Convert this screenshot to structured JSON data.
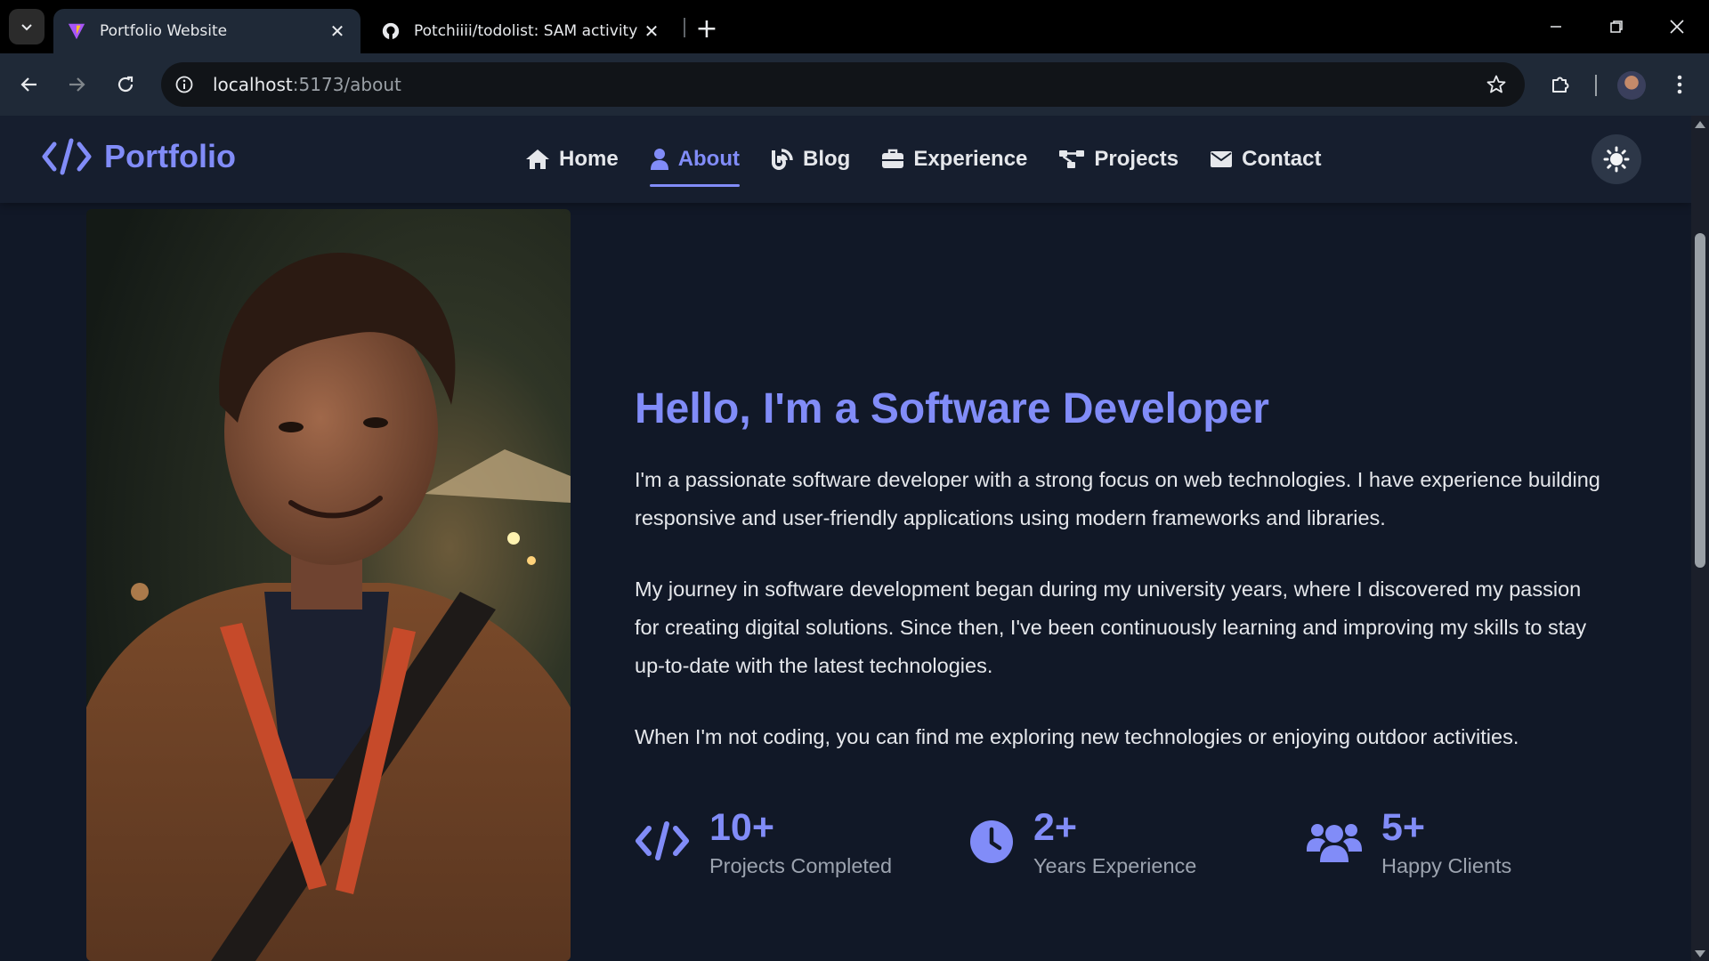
{
  "browser": {
    "tabs": [
      {
        "title": "Portfolio Website",
        "active": true,
        "favicon": "vite-icon"
      },
      {
        "title": "Potchiiii/todolist: SAM activity",
        "active": false,
        "favicon": "github-icon"
      }
    ],
    "url_host": "localhost",
    "url_path": ":5173/about"
  },
  "site": {
    "logo_text": "Portfolio",
    "nav": [
      {
        "label": "Home",
        "icon": "home-icon",
        "active": false
      },
      {
        "label": "About",
        "icon": "user-icon",
        "active": true
      },
      {
        "label": "Blog",
        "icon": "blog-icon",
        "active": false
      },
      {
        "label": "Experience",
        "icon": "briefcase-icon",
        "active": false
      },
      {
        "label": "Projects",
        "icon": "project-diagram-icon",
        "active": false
      },
      {
        "label": "Contact",
        "icon": "envelope-icon",
        "active": false
      }
    ],
    "theme_toggle_icon": "sun-icon"
  },
  "about": {
    "headline": "Hello, I'm a Software Developer",
    "paragraphs": [
      "I'm a passionate software developer with a strong focus on web technologies. I have experience building responsive and user-friendly applications using modern frameworks and libraries.",
      "My journey in software development began during my university years, where I discovered my passion for creating digital solutions. Since then, I've been continuously learning and improving my skills to stay up-to-date with the latest technologies.",
      "When I'm not coding, you can find me exploring new technologies or enjoying outdoor activities."
    ],
    "stats": [
      {
        "value": "10+",
        "label": "Projects Completed",
        "icon": "code-icon"
      },
      {
        "value": "2+",
        "label": "Years Experience",
        "icon": "clock-icon"
      },
      {
        "value": "5+",
        "label": "Happy Clients",
        "icon": "users-icon"
      }
    ]
  },
  "colors": {
    "accent": "#818cf8",
    "page_bg": "#111827",
    "header_bg": "#161e2e",
    "text": "#e5e7eb",
    "muted": "#9ca3af"
  }
}
